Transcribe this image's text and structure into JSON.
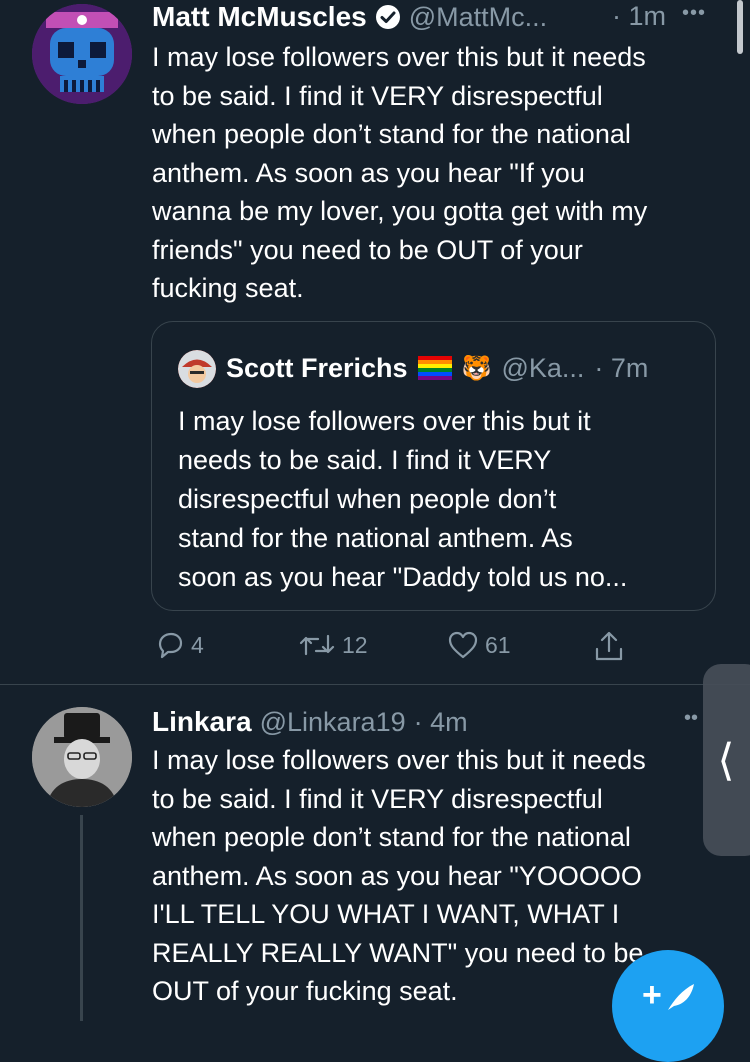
{
  "tweets": [
    {
      "name": "Matt McMuscles",
      "handle": "@MattMc...",
      "time": "· 1m",
      "more": "•••",
      "text": "I may lose followers over this but it needs\nto be said. I find it VERY disrespectful\nwhen people don’t stand for the national\nanthem. As soon as you hear \"If you\nwanna be my lover, you gotta get with my\nfriends\" you need to be OUT of your\nfucking seat.",
      "quote": {
        "name": "Scott Frerichs",
        "emoji": "🐯",
        "handle": "@Ka...",
        "time": "· 7m",
        "text": "I may lose followers over this but it\nneeds to be said. I find it VERY\ndisrespectful when people don’t\nstand for the national anthem. As\nsoon as you hear \"Daddy told us no..."
      },
      "replies": "4",
      "retweets": "12",
      "likes": "61"
    },
    {
      "name": "Linkara",
      "handle": "@Linkara19",
      "time": "· 4m",
      "more": "••",
      "text": "I may lose followers over this but it needs\nto be said. I find it VERY disrespectful\nwhen people don’t stand for the national\nanthem. As soon as you hear \"YOOOOO\nI'LL TELL YOU WHAT I WANT, WHAT I\nREALLY REALLY WANT\" you need to be\nOUT of your fucking seat."
    }
  ],
  "side_tab": {
    "glyph": "⟨"
  },
  "compose": {
    "glyph": "+"
  },
  "colors": {
    "background": "#15202b",
    "muted": "#8899a6",
    "accent": "#1da1f2"
  }
}
